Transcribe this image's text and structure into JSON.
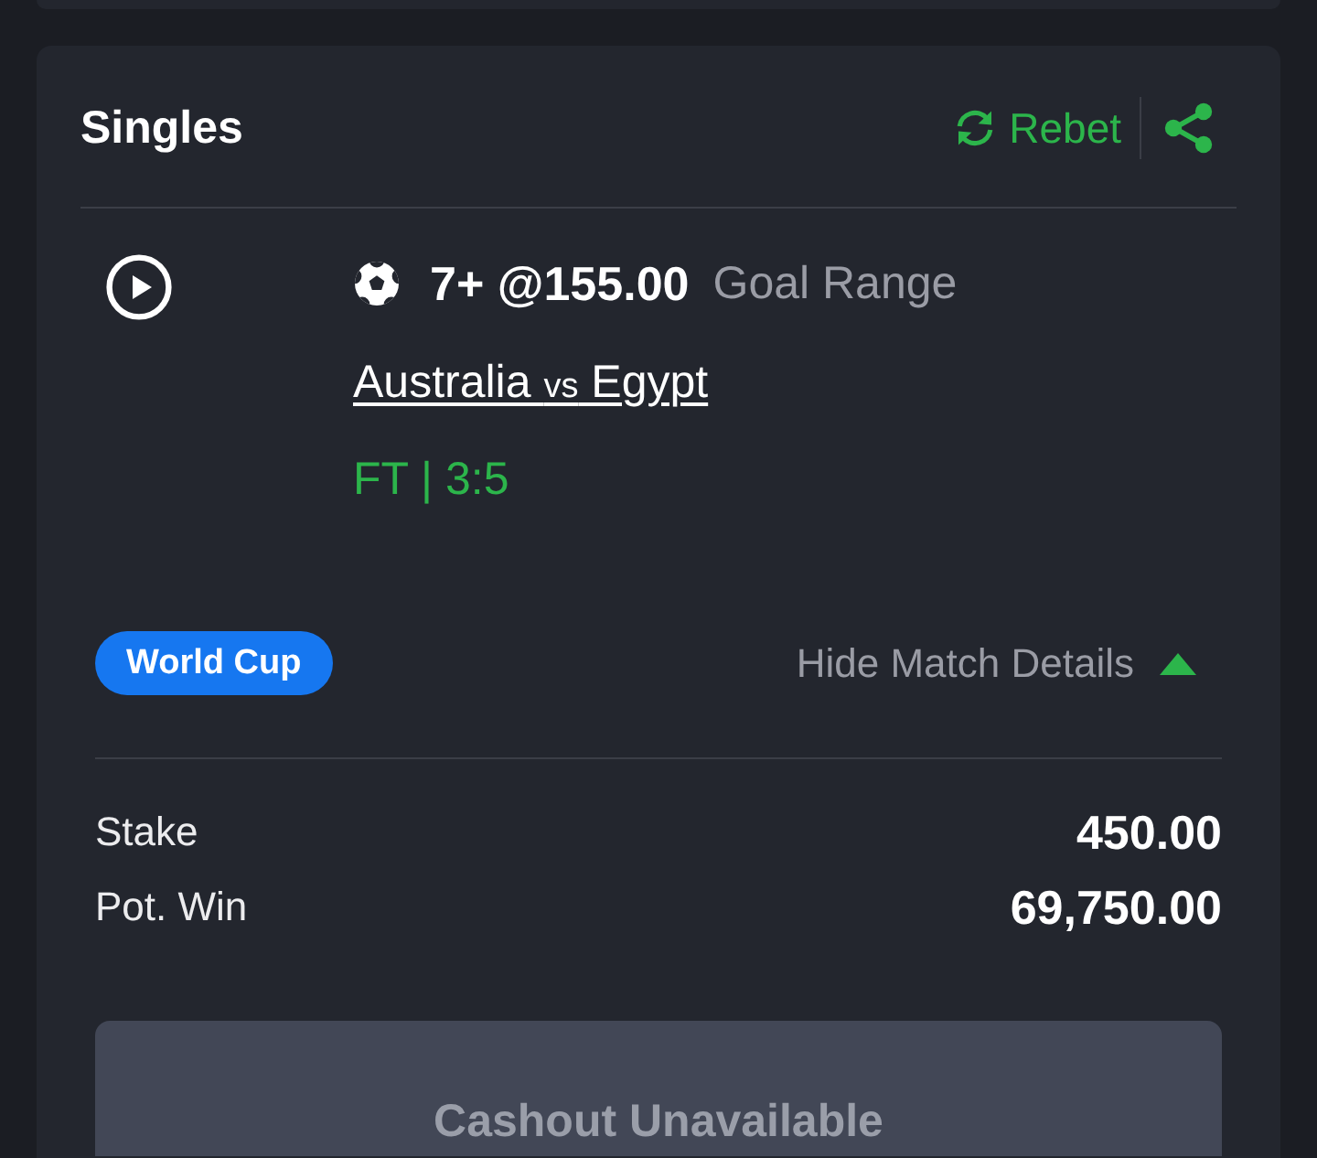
{
  "section": {
    "title": "Singles",
    "rebet_label": "Rebet"
  },
  "selection": {
    "pick": "7+ @155.00",
    "market": "Goal Range",
    "match": {
      "home": "Australia",
      "separator": "vs",
      "away": "Egypt"
    },
    "result": "FT | 3:5",
    "competition": "World Cup",
    "details_toggle": {
      "label": "Hide Match Details",
      "expanded": true
    }
  },
  "summary": [
    {
      "label": "Stake",
      "value": "450.00"
    },
    {
      "label": "Pot. Win",
      "value": "69,750.00"
    }
  ],
  "cashout": {
    "label": "Cashout Unavailable",
    "disabled": true
  }
}
